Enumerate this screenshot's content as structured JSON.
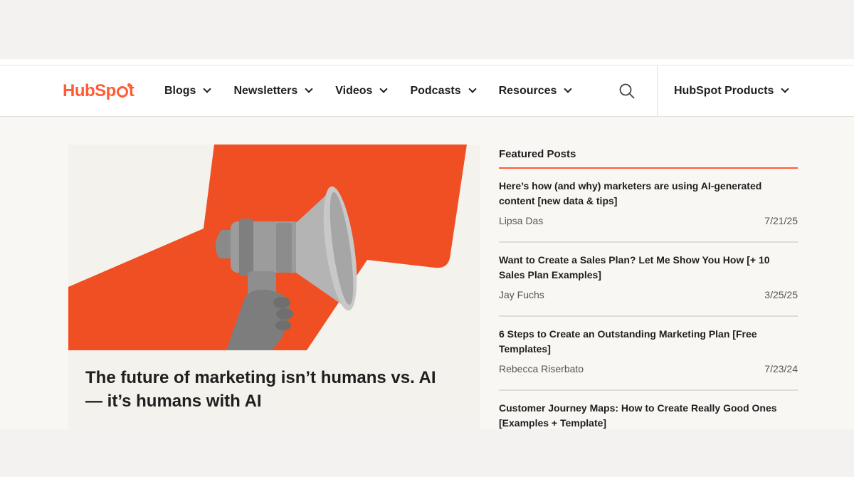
{
  "brand": {
    "logo_prefix": "HubSp",
    "logo_suffix": "t",
    "accent": "#ff5c35"
  },
  "nav": {
    "items": [
      {
        "label": "Blogs"
      },
      {
        "label": "Newsletters"
      },
      {
        "label": "Videos"
      },
      {
        "label": "Podcasts"
      },
      {
        "label": "Resources"
      }
    ],
    "search_icon": "search-icon",
    "products_label": "HubSpot Products"
  },
  "hero": {
    "title": "The future of marketing isn’t humans vs. AI — it’s humans with AI",
    "image": "megaphone-in-hand-illustration"
  },
  "featured": {
    "heading": "Featured Posts",
    "posts": [
      {
        "title": "Here’s how (and why) marketers are using AI-generated content [new data & tips]",
        "author": "Lipsa Das",
        "date": "7/21/25"
      },
      {
        "title": "Want to Create a Sales Plan? Let Me Show You How [+ 10 Sales Plan Examples]",
        "author": "Jay Fuchs",
        "date": "3/25/25"
      },
      {
        "title": "6 Steps to Create an Outstanding Marketing Plan [Free Templates]",
        "author": "Rebecca Riserbato",
        "date": "7/23/24"
      },
      {
        "title": "Customer Journey Maps: How to Create Really Good Ones [Examples + Template]",
        "author": "",
        "date": ""
      }
    ]
  }
}
